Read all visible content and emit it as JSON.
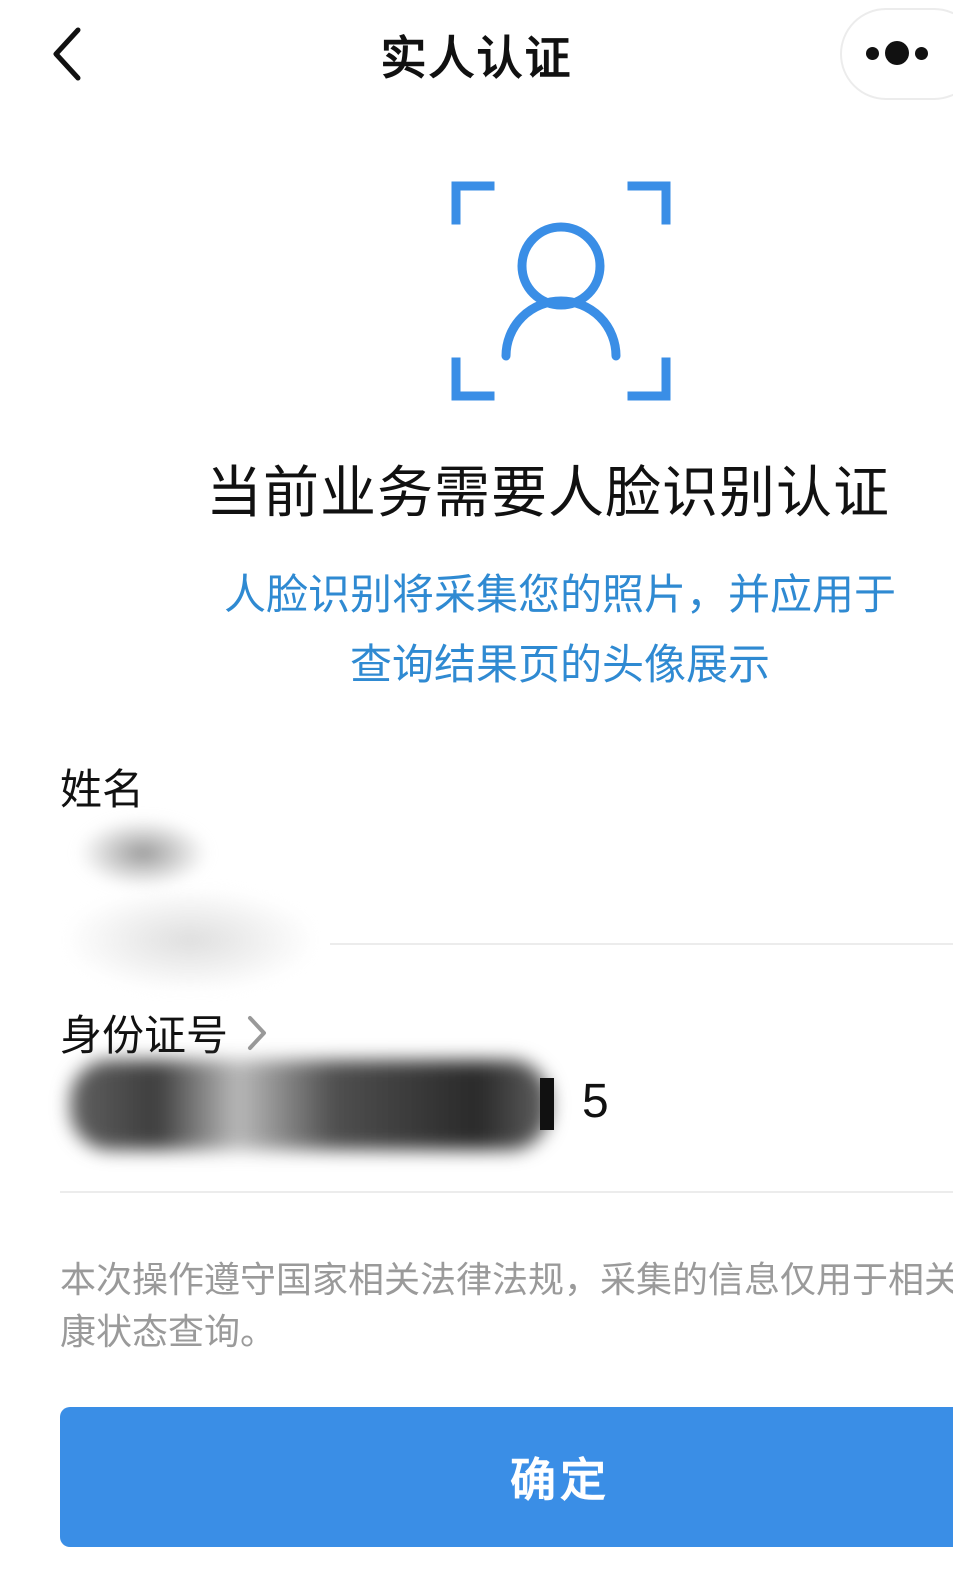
{
  "header": {
    "title": "实人认证",
    "back_icon": "chevron-left-icon",
    "more_icon": "more-dots-icon"
  },
  "face_icon": {
    "name": "face-recognition-icon",
    "color": "#3a8ee6"
  },
  "main": {
    "heading": "当前业务需要人脸识别认证",
    "notice_line1": "人脸识别将采集您的照片，并应用于",
    "notice_line2": "查询结果页的头像展示",
    "notice_color": "#2f8ad2"
  },
  "form": {
    "name_label": "姓名",
    "name_value_redacted": true,
    "id_label": "身份证号",
    "id_value_visible_suffix": "5"
  },
  "footer": {
    "disclaimer": "本次操作遵守国家相关法律法规，采集的信息仅用于相关健康状态查询。",
    "confirm_label": "确定",
    "button_color": "#3a8ee6"
  }
}
